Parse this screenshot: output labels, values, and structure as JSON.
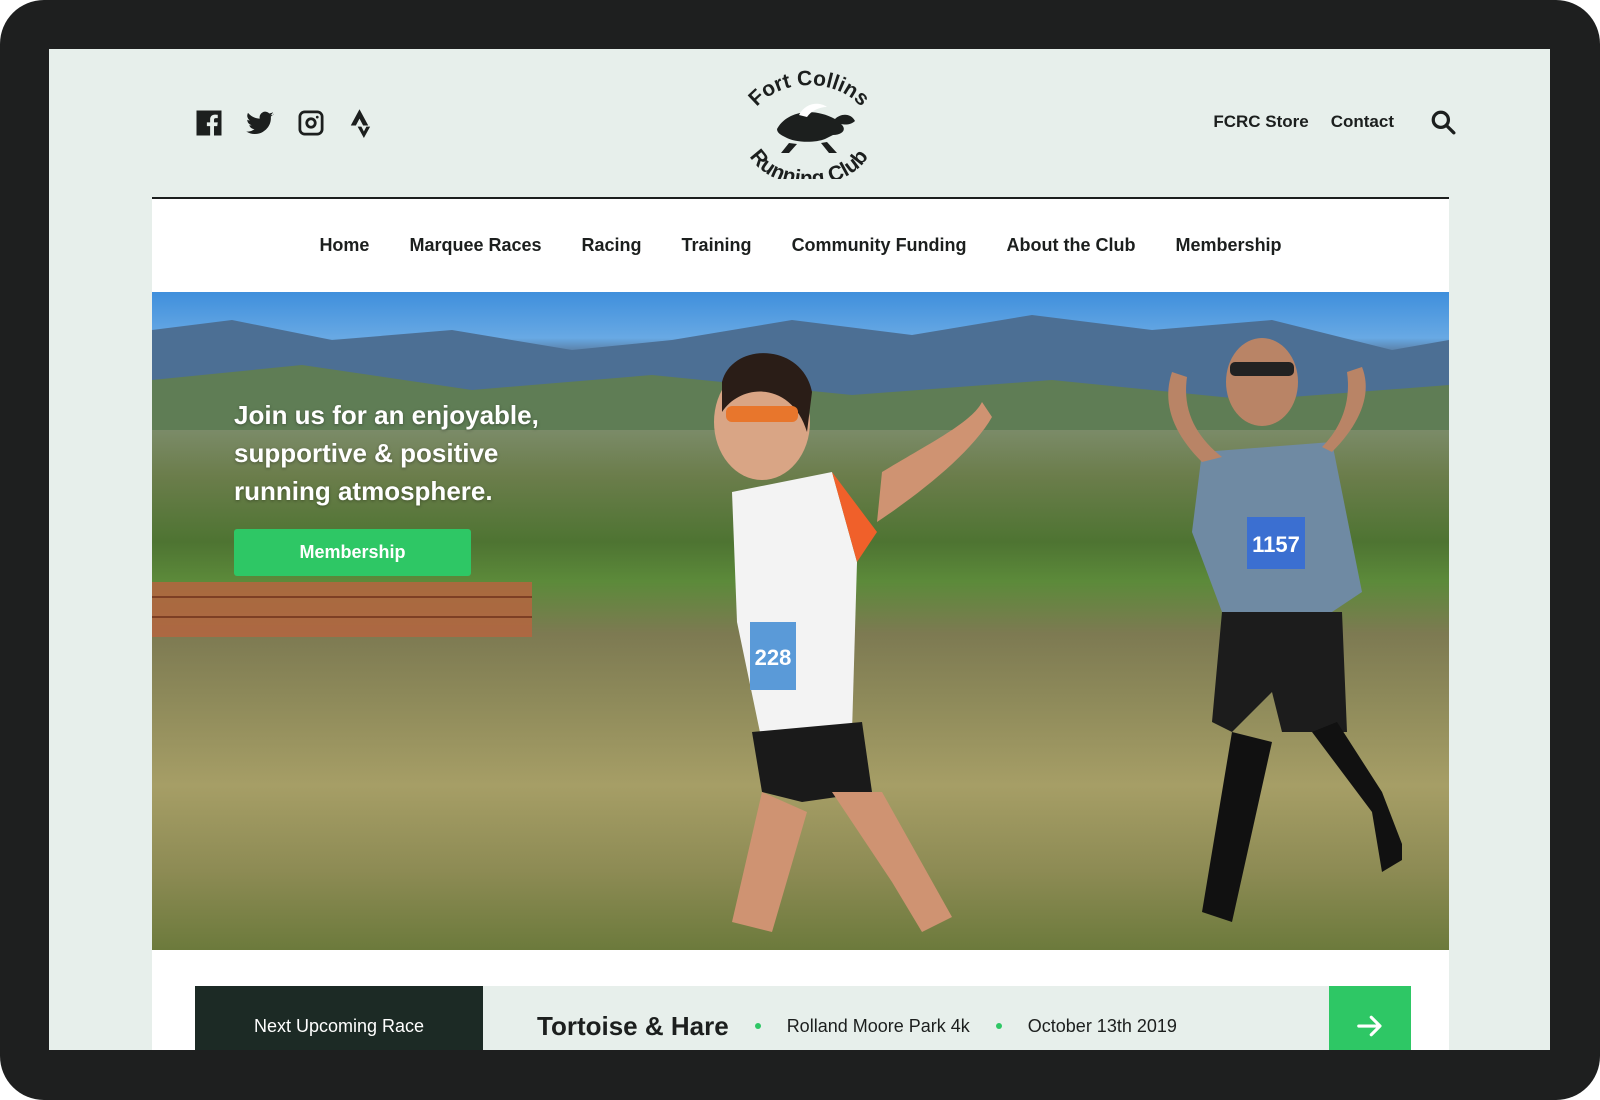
{
  "header": {
    "social": [
      {
        "icon": "facebook-icon"
      },
      {
        "icon": "twitter-icon"
      },
      {
        "icon": "instagram-icon"
      },
      {
        "icon": "strava-icon"
      }
    ],
    "logo": {
      "line1": "Fort Collins",
      "line2": "Running Club"
    },
    "links": [
      {
        "label": "FCRC Store"
      },
      {
        "label": "Contact"
      }
    ],
    "search_icon": "search-icon"
  },
  "nav": {
    "items": [
      {
        "label": "Home"
      },
      {
        "label": "Marquee Races"
      },
      {
        "label": "Racing"
      },
      {
        "label": "Training"
      },
      {
        "label": "Community Funding"
      },
      {
        "label": "About the Club"
      },
      {
        "label": "Membership"
      }
    ]
  },
  "hero": {
    "headline": "Join us for an enjoyable, supportive & positive running atmosphere.",
    "button_label": "Membership",
    "bib_left": "228",
    "bib_right": "1157"
  },
  "race": {
    "label": "Next Upcoming Race",
    "name": "Tortoise & Hare",
    "location": "Rolland Moore Park 4k",
    "date": "October 13th 2019"
  },
  "colors": {
    "accent": "#2ec765",
    "dark": "#1c2a25",
    "background": "#e7efeb"
  }
}
